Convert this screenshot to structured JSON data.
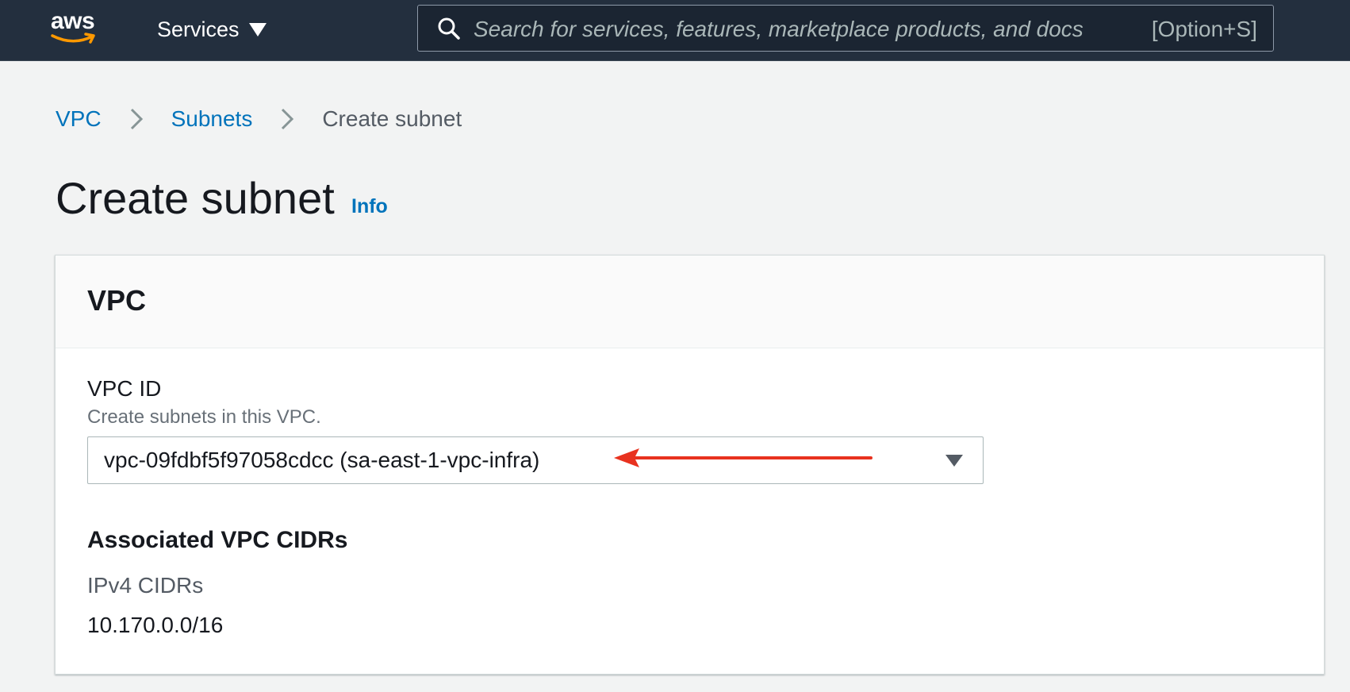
{
  "nav": {
    "logo_text": "aws",
    "logo_icon": "amazon-smile-arrow",
    "services_label": "Services",
    "search": {
      "placeholder": "Search for services, features, marketplace products, and docs",
      "shortcut": "[Option+S]"
    }
  },
  "breadcrumb": {
    "items": [
      "VPC",
      "Subnets"
    ],
    "current": "Create subnet"
  },
  "page": {
    "title": "Create subnet",
    "info_link": "Info"
  },
  "vpc_section": {
    "header": "VPC",
    "vpc_id_label": "VPC ID",
    "vpc_id_description": "Create subnets in this VPC.",
    "vpc_id_selected": "vpc-09fdbf5f97058cdcc (sa-east-1-vpc-infra)",
    "associated_cidrs_heading": "Associated VPC CIDRs",
    "ipv4_label": "IPv4 CIDRs",
    "ipv4_value": "10.170.0.0/16"
  },
  "colors": {
    "nav_background": "#232f3e",
    "link": "#0073bb",
    "logo_accent": "#ff9900",
    "annotation_arrow": "#e8321f",
    "page_background": "#f2f3f3"
  }
}
